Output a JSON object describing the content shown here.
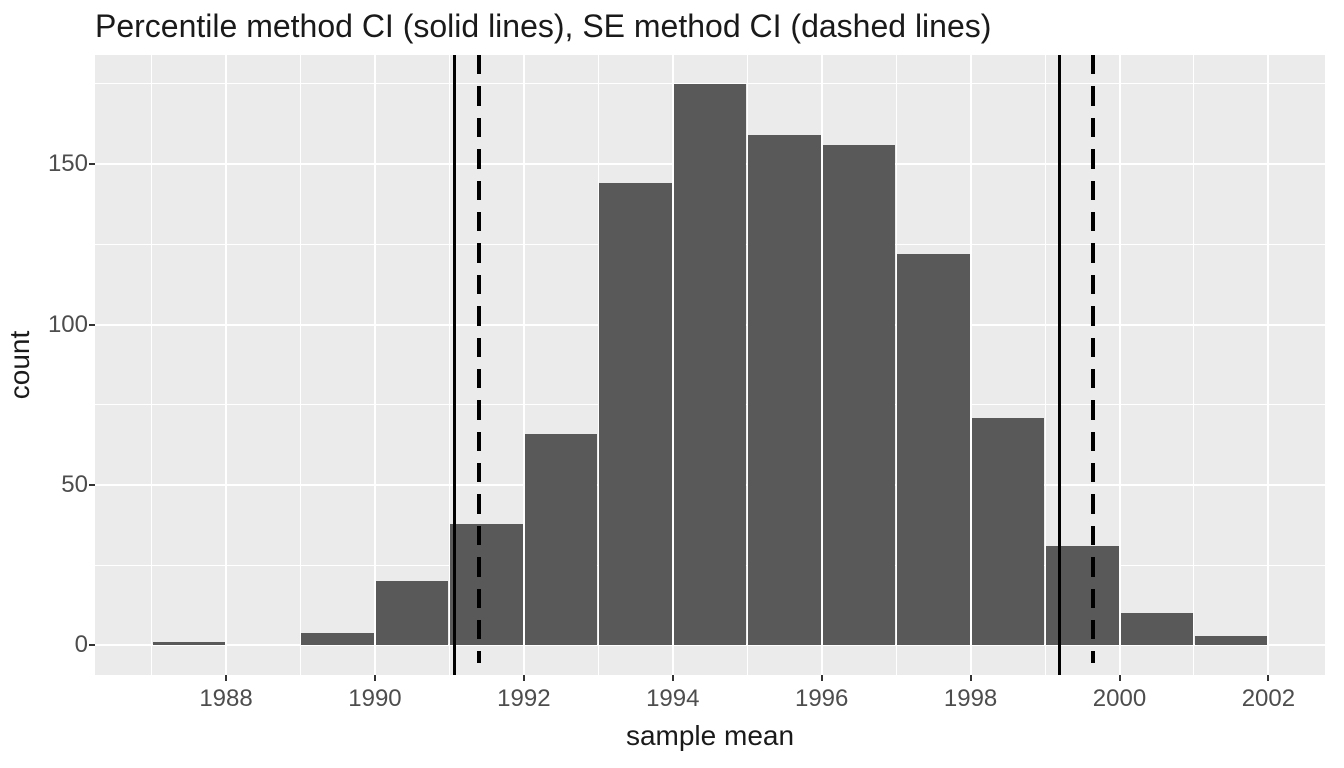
{
  "chart_data": {
    "type": "bar",
    "title": "Percentile method CI (solid lines), SE method CI (dashed lines)",
    "xlabel": "sample mean",
    "ylabel": "count",
    "bin_edges_x": [
      1987,
      1988,
      1989,
      1990,
      1991,
      1992,
      1993,
      1994,
      1995,
      1996,
      1997,
      1998,
      1999,
      2000,
      2001,
      2002
    ],
    "values": [
      1,
      0,
      4,
      20,
      38,
      66,
      144,
      175,
      159,
      156,
      122,
      71,
      31,
      10,
      3
    ],
    "x_ticks": [
      1988,
      1990,
      1992,
      1994,
      1996,
      1998,
      2000,
      2002
    ],
    "y_ticks": [
      0,
      50,
      100,
      150
    ],
    "ylim": [
      -9.2,
      184
    ],
    "xlim": [
      1986.24,
      2002.76
    ],
    "ci_solid": [
      1991.075,
      1999.2
    ],
    "ci_dashed": [
      1991.4,
      1999.65
    ],
    "series_color": "#595959",
    "line_styles": {
      "percentile": "solid",
      "se": "dashed"
    }
  }
}
